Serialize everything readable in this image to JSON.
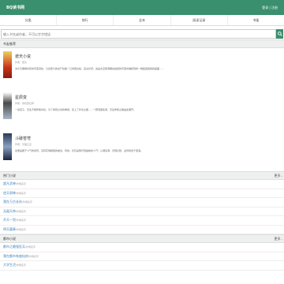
{
  "header": {
    "logo": "BQ读书网",
    "auth": "登录 | 注册"
  },
  "nav": [
    "分类",
    "排行",
    "全本",
    "阅读记录",
    "书架"
  ],
  "search": {
    "placeholder": "输入书名或作者，不可以字字错误",
    "value": ""
  },
  "featured": {
    "title": "书友推荐",
    "books": [
      {
        "title": "遮天小说",
        "meta": "作者：辰东",
        "desc": "冰冷与黑暗并存的宇宙深处，九具庞大的龙尸拉着一口青铜古棺，亘古长存。这是太空探测器在枯寂的宇宙中捕捉到的一幅极其震撼的画面……"
      },
      {
        "title": "星辰变",
        "meta": "作者：我吃西红柿",
        "desc": "一名孩子，天生不能修炼内功，为了得到父亲的重视，走上了外功之路……一颗流星坠落，天生修炼之路由此展开。"
      },
      {
        "title": "斗破苍穹",
        "meta": "作者：天蚕土豆",
        "desc": "这里是属于斗气的世界，没有花俏艳丽的魔法，有的，仅仅是繁衍到巅峰的斗气！心潮澎湃，无限幻想，迎风挥击千层浪。"
      }
    ]
  },
  "popular": {
    "title": "热门小说",
    "more": "更多..",
    "items": [
      {
        "title": "超凡武神",
        "author": "/作者名字"
      },
      {
        "title": "逆天邪神",
        "author": "/作者名字"
      },
      {
        "title": "我在万古长存",
        "author": "/作者名字"
      },
      {
        "title": "无敌天帝",
        "author": "/作者名字"
      },
      {
        "title": "开天一剑",
        "author": "/作者名字"
      },
      {
        "title": "明天篇章",
        "author": "/作者名字"
      }
    ]
  },
  "recent": {
    "title": "都市小说",
    "more": "更多..",
    "items": [
      {
        "title": "都市之最强狂兵",
        "author": "/作者名字"
      },
      {
        "title": "我在都市有座仙府",
        "author": "/作者名字"
      },
      {
        "title": "大学生活",
        "author": "/作者名字"
      }
    ]
  },
  "colors": {
    "brand": "#3a8f6e",
    "link": "#3a7fbf"
  }
}
